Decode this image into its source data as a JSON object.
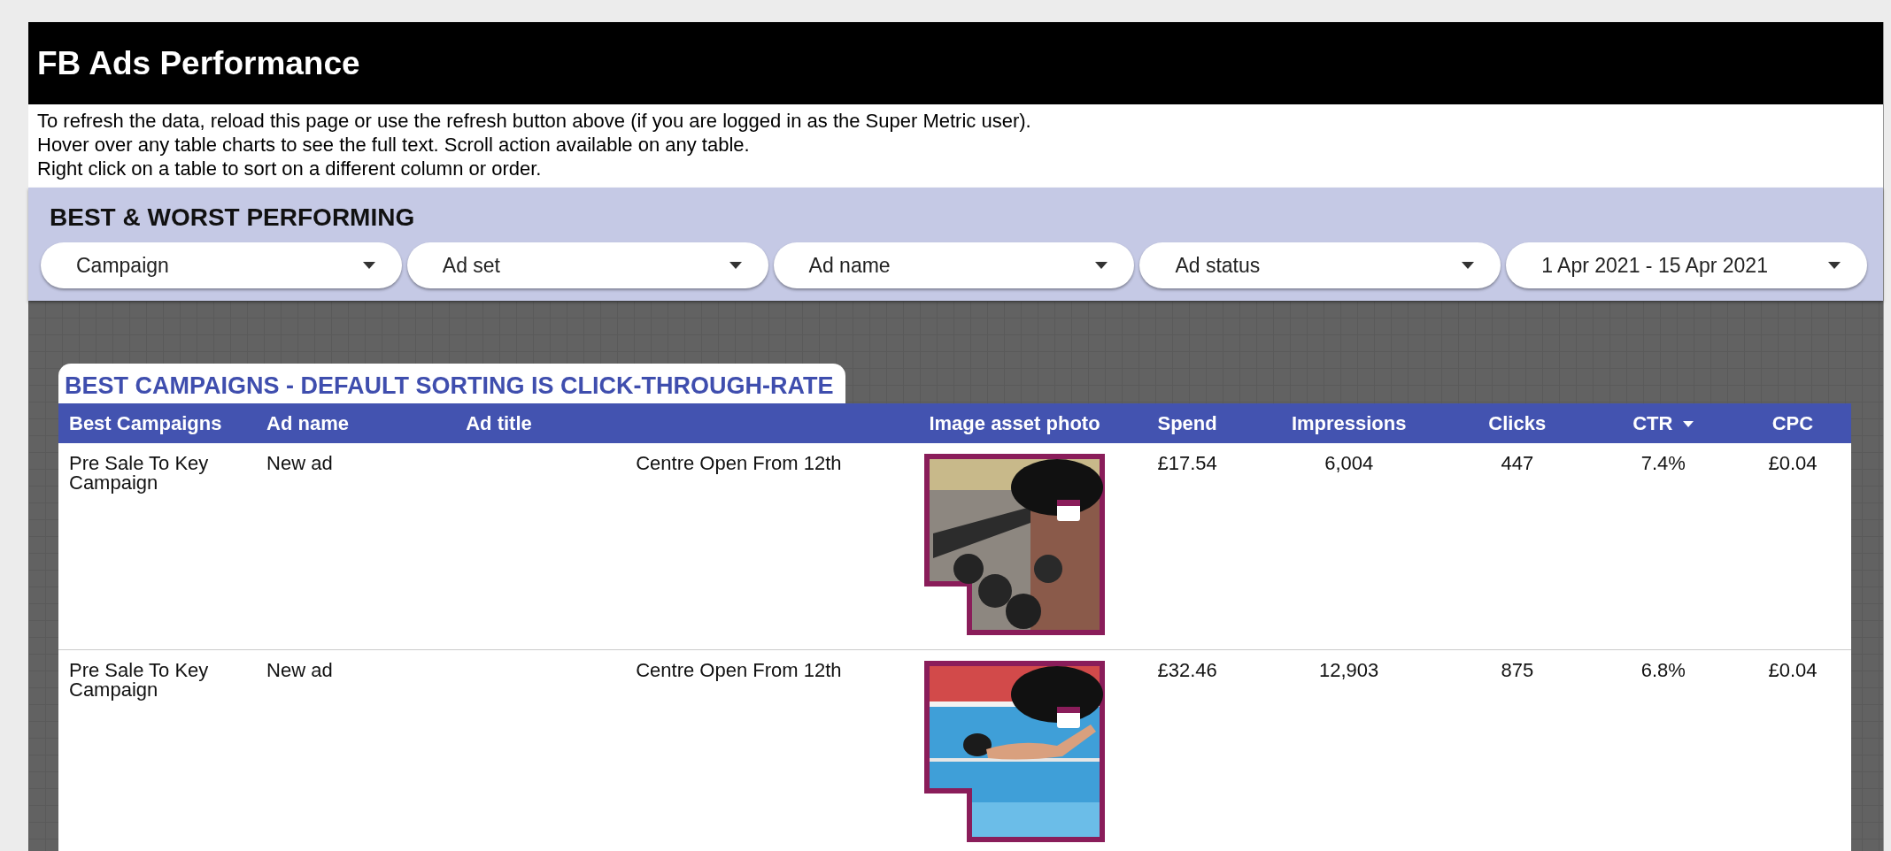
{
  "header": {
    "title": "FB Ads Performance"
  },
  "notes": [
    "To refresh the data, reload this page or use the refresh button above (if you are logged in as the Super Metric user).",
    "Hover over any table charts to see the full text. Scroll action available on any table.",
    "Right click on a table to sort on a different column or order."
  ],
  "section": {
    "title": "BEST & WORST PERFORMING",
    "filters": [
      {
        "label": "Campaign"
      },
      {
        "label": "Ad set"
      },
      {
        "label": "Ad name"
      },
      {
        "label": "Ad status"
      },
      {
        "label": "1 Apr 2021 - 15 Apr 2021"
      }
    ]
  },
  "table": {
    "title": "BEST CAMPAIGNS - DEFAULT SORTING IS CLICK-THROUGH-RATE",
    "columns": [
      {
        "label": "Best Campaigns",
        "sorted": false
      },
      {
        "label": "Ad name",
        "sorted": false
      },
      {
        "label": "Ad title",
        "sorted": false
      },
      {
        "label": "Image asset photo",
        "sorted": false
      },
      {
        "label": "Spend",
        "sorted": false
      },
      {
        "label": "Impressions",
        "sorted": false
      },
      {
        "label": "Clicks",
        "sorted": false
      },
      {
        "label": "CTR",
        "sorted": true
      },
      {
        "label": "CPC",
        "sorted": false
      }
    ],
    "rows": [
      {
        "cells": [
          "Pre Sale To Key Campaign",
          "New ad",
          "Centre Open From 12th",
          {
            "kind": "picture"
          },
          "£17.54",
          "6,004",
          "447",
          "7.4%",
          "£0.04"
        ]
      },
      {
        "cells": [
          "Pre Sale To Key Campaign",
          "New ad",
          "Centre Open From 12th",
          {
            "kind": "picture"
          },
          "£32.46",
          "12,903",
          "875",
          "6.8%",
          "£0.04"
        ]
      }
    ]
  }
}
